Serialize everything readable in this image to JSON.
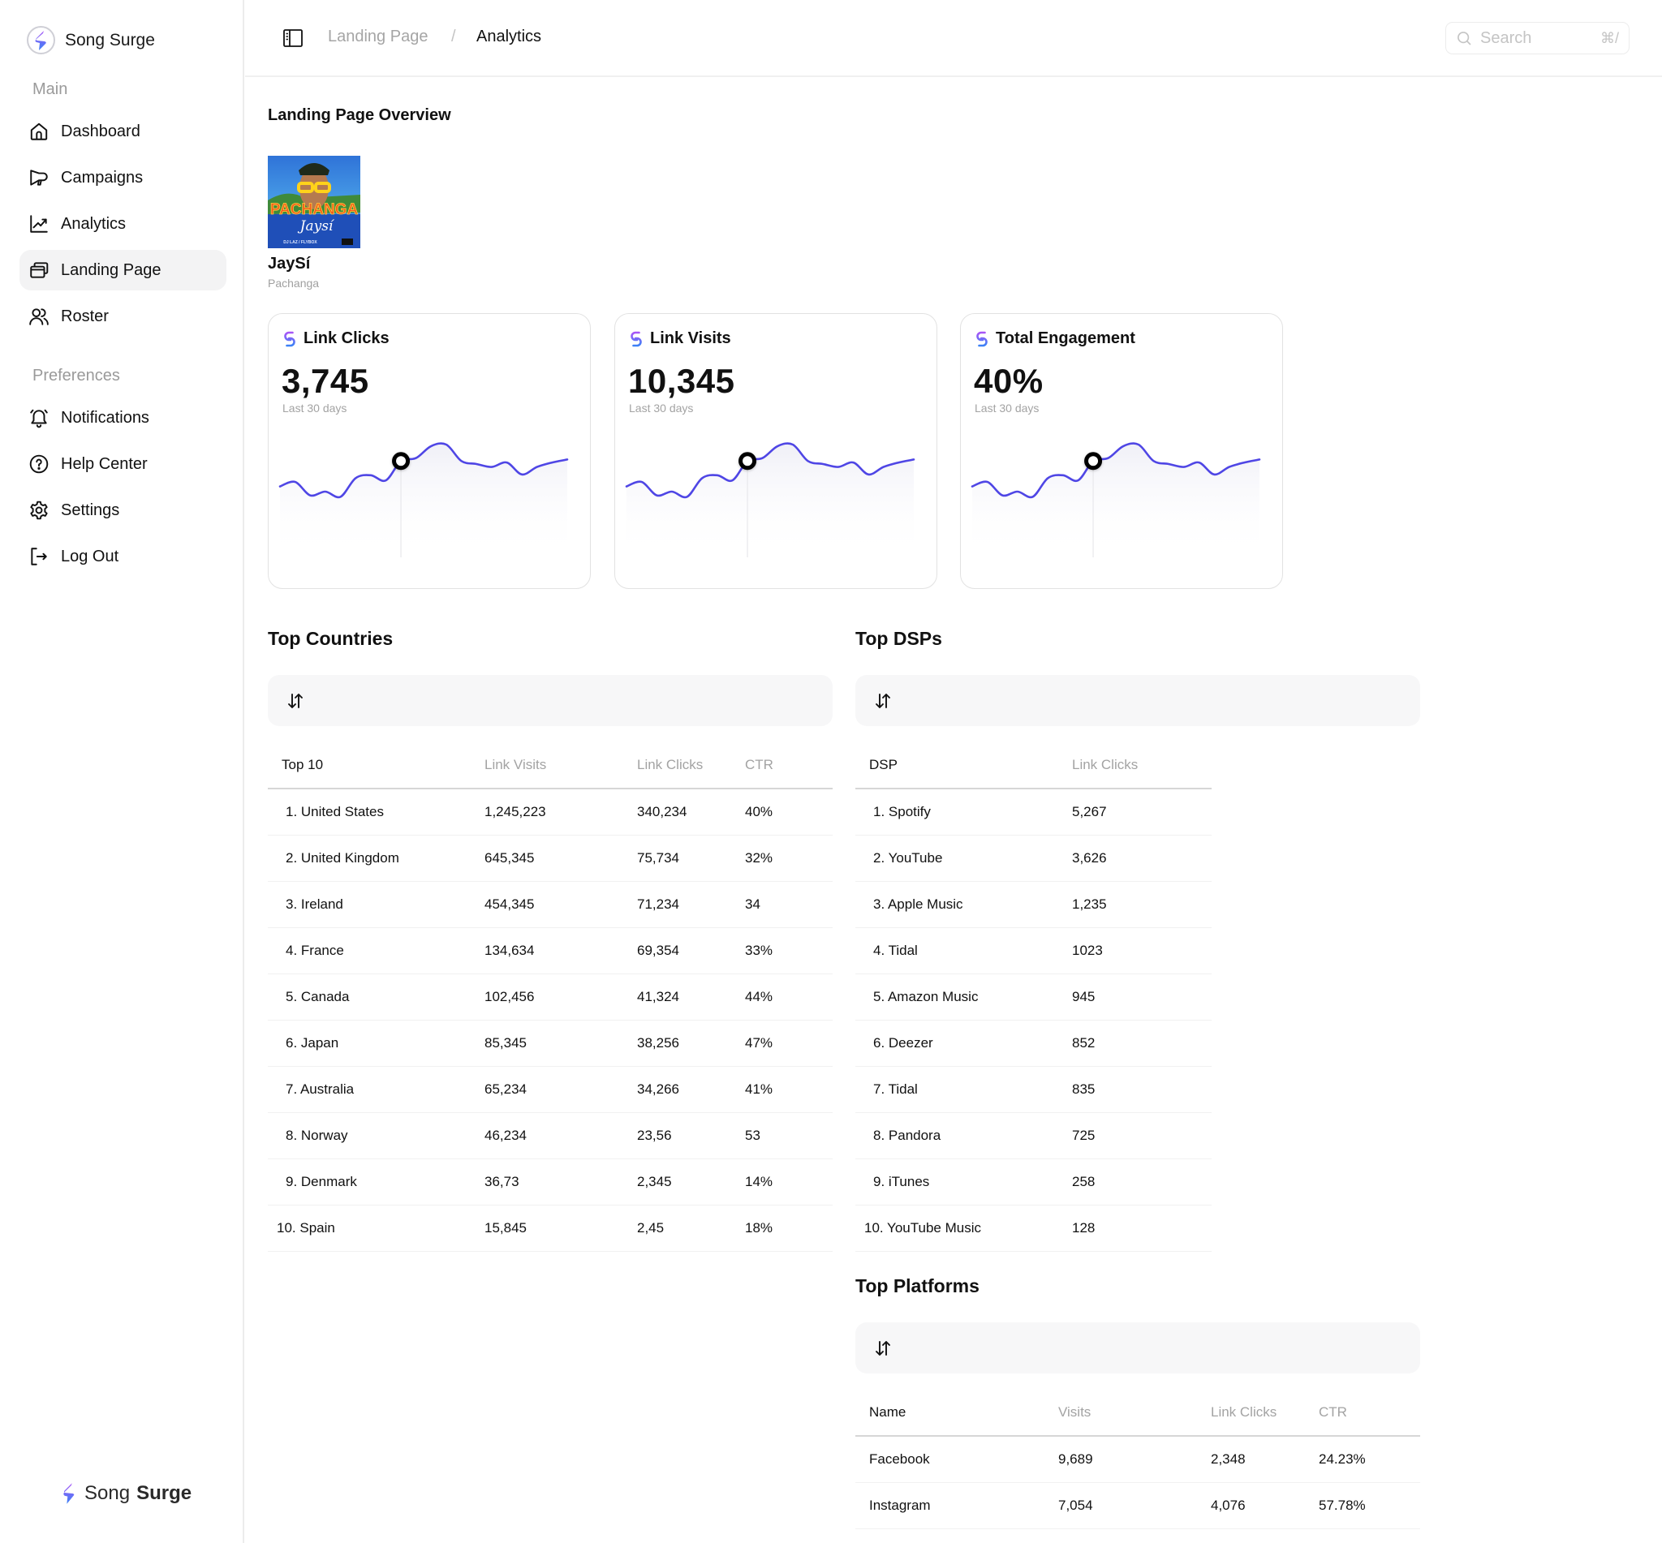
{
  "app": {
    "name": "Song Surge",
    "footer_name_light": "Song",
    "footer_name_bold": "Surge",
    "accent_color": "#4f46e5",
    "logo_gradient": [
      "#a855f7",
      "#3b82f6"
    ]
  },
  "sidebar": {
    "sections": [
      {
        "label": "Main",
        "items": [
          {
            "label": "Dashboard",
            "icon": "home-icon",
            "active": false
          },
          {
            "label": "Campaigns",
            "icon": "megaphone-icon",
            "active": false
          },
          {
            "label": "Analytics",
            "icon": "chart-line-icon",
            "active": false
          },
          {
            "label": "Landing Page",
            "icon": "windows-stack-icon",
            "active": true
          },
          {
            "label": "Roster",
            "icon": "users-icon",
            "active": false
          }
        ]
      },
      {
        "label": "Preferences",
        "items": [
          {
            "label": "Notifications",
            "icon": "bell-icon",
            "active": false
          },
          {
            "label": "Help Center",
            "icon": "help-circle-icon",
            "active": false
          },
          {
            "label": "Settings",
            "icon": "gear-icon",
            "active": false
          },
          {
            "label": "Log Out",
            "icon": "logout-icon",
            "active": false
          }
        ]
      }
    ]
  },
  "topbar": {
    "breadcrumb": [
      "Landing Page",
      "Analytics"
    ],
    "breadcrumb_separator": "/",
    "search": {
      "placeholder": "Search",
      "value": "",
      "shortcut": "⌘/"
    }
  },
  "overview": {
    "title": "Landing Page Overview",
    "release": {
      "artist": "JaySí",
      "title": "Pachanga",
      "cover_text": "PACHANGA",
      "cover_script": "Jaysí",
      "cover_credits": "DJ LAZ / FLYBOX"
    }
  },
  "kpis": [
    {
      "label": "Link Clicks",
      "value": "3,745",
      "period": "Last 30 days",
      "icon": "link-icon"
    },
    {
      "label": "Link Visits",
      "value": "10,345",
      "period": "Last 30 days",
      "icon": "link-icon"
    },
    {
      "label": "Total Engagement",
      "value": "40%",
      "period": "Last 30 days",
      "icon": "link-icon"
    }
  ],
  "chart_data": {
    "type": "line",
    "title": "Last 30 days trend (sparkline, shared by all KPI cards)",
    "x": [
      0,
      1,
      2,
      3,
      4,
      5,
      6,
      7,
      8,
      9,
      10,
      11,
      12,
      13,
      14,
      15,
      16,
      17,
      18,
      19
    ],
    "series": [
      {
        "name": "trend",
        "color": "#4f46e5",
        "values": [
          32,
          38,
          20,
          25,
          18,
          43,
          47,
          40,
          66,
          70,
          86,
          88,
          66,
          62,
          58,
          64,
          48,
          58,
          64,
          68
        ]
      }
    ],
    "highlight_index": 8,
    "ylim": [
      0,
      100
    ],
    "grid": false,
    "xlabel": "",
    "ylabel": ""
  },
  "top_countries": {
    "title": "Top Countries",
    "columns": [
      "Top 10",
      "Link Visits",
      "Link Clicks",
      "CTR"
    ],
    "rows": [
      [
        "1. United States",
        "1,245,223",
        "340,234",
        "40%"
      ],
      [
        "2. United Kingdom",
        "645,345",
        "75,734",
        "32%"
      ],
      [
        "3. Ireland",
        "454,345",
        "71,234",
        "34"
      ],
      [
        "4. France",
        "134,634",
        "69,354",
        "33%"
      ],
      [
        "5. Canada",
        "102,456",
        "41,324",
        "44%"
      ],
      [
        "6. Japan",
        "85,345",
        "38,256",
        "47%"
      ],
      [
        "7. Australia",
        "65,234",
        "34,266",
        "41%"
      ],
      [
        "8. Norway",
        "46,234",
        "23,56",
        "53"
      ],
      [
        "9. Denmark",
        "36,73",
        "2,345",
        "14%"
      ],
      [
        "10. Spain",
        "15,845",
        "2,45",
        "18%"
      ]
    ]
  },
  "top_dsps": {
    "title": "Top DSPs",
    "columns": [
      "DSP",
      "Link Clicks"
    ],
    "rows": [
      [
        "1. Spotify",
        "5,267"
      ],
      [
        "2. YouTube",
        "3,626"
      ],
      [
        "3. Apple Music",
        "1,235"
      ],
      [
        "4. Tidal",
        "1023"
      ],
      [
        "5. Amazon Music",
        "945"
      ],
      [
        "6. Deezer",
        "852"
      ],
      [
        "7. Tidal",
        "835"
      ],
      [
        "8. Pandora",
        "725"
      ],
      [
        "9. iTunes",
        "258"
      ],
      [
        "10. YouTube Music",
        "128"
      ]
    ]
  },
  "top_platforms": {
    "title": "Top Platforms",
    "columns": [
      "Name",
      "Visits",
      "Link Clicks",
      "CTR"
    ],
    "rows": [
      [
        "Facebook",
        "9,689",
        "2,348",
        "24.23%"
      ],
      [
        "Instagram",
        "7,054",
        "4,076",
        "57.78%"
      ]
    ]
  }
}
